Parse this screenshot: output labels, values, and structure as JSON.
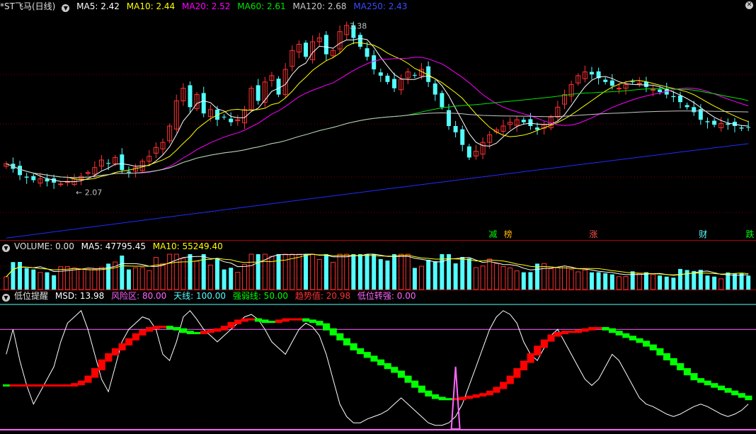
{
  "colors": {
    "bg": "#000000",
    "up": "#ff3232",
    "down": "#54ffff",
    "ma5": "#ffffff",
    "ma10": "#ffff00",
    "ma20": "#ff00ff",
    "ma60": "#00e600",
    "ma120": "#c8c8c8",
    "ma250": "#1e2cff",
    "grid": "#7a0000"
  },
  "main_legend": {
    "title": "*ST飞马(日线)",
    "ma5": "MA5: 2.42",
    "ma10": "MA10: 2.44",
    "ma20": "MA20: 2.52",
    "ma60": "MA60: 2.61",
    "ma120": "MA120: 2.68",
    "ma250": "MA250: 2.43"
  },
  "vol_legend": {
    "volume": "VOLUME: 0.00",
    "ma5": "MA5: 47795.45",
    "ma10": "MA10: 55249.40"
  },
  "ind_legend": {
    "name": "低位提醒",
    "msd": "MSD: 13.98",
    "risk": "风险区: 80.00",
    "sky": "天线: 100.00",
    "strong": "强弱线: 50.00",
    "trend": "趋势值: 20.98",
    "low": "低位转强: 0.00"
  },
  "annotations": {
    "high_label": "3.38",
    "low_label": "← 2.07"
  },
  "event_markers": [
    {
      "label": "减",
      "color": "#00ff00",
      "pos": 0.652
    },
    {
      "label": "榜",
      "color": "#ffb400",
      "pos": 0.672
    },
    {
      "label": "涨",
      "color": "#ff5050",
      "pos": 0.785
    },
    {
      "label": "财",
      "color": "#54ffff",
      "pos": 0.93
    },
    {
      "label": "跌",
      "color": "#00ff00",
      "pos": 0.992
    }
  ],
  "chart_data": {
    "type": "candlestick",
    "title": "*ST飞马(日线)",
    "price_range": [
      1.65,
      3.45
    ],
    "high": 3.38,
    "low": 2.07,
    "closes": [
      2.25,
      2.21,
      2.16,
      2.14,
      2.12,
      2.13,
      2.11,
      2.1,
      2.09,
      2.11,
      2.13,
      2.15,
      2.18,
      2.22,
      2.28,
      2.25,
      2.3,
      2.2,
      2.18,
      2.22,
      2.27,
      2.31,
      2.38,
      2.42,
      2.55,
      2.75,
      2.85,
      2.7,
      2.8,
      2.65,
      2.68,
      2.6,
      2.62,
      2.58,
      2.6,
      2.68,
      2.85,
      2.75,
      2.9,
      2.95,
      2.8,
      3.0,
      3.15,
      3.2,
      3.1,
      3.22,
      3.25,
      3.12,
      3.15,
      3.3,
      3.35,
      3.25,
      3.18,
      3.1,
      3.0,
      2.95,
      2.9,
      2.85,
      2.92,
      2.98,
      2.95,
      3.0,
      2.9,
      2.8,
      2.7,
      2.55,
      2.5,
      2.4,
      2.3,
      2.35,
      2.42,
      2.48,
      2.52,
      2.55,
      2.58,
      2.6,
      2.58,
      2.55,
      2.52,
      2.56,
      2.62,
      2.7,
      2.8,
      2.88,
      2.95,
      2.98,
      2.96,
      2.93,
      2.9,
      2.87,
      2.85,
      2.88,
      2.9,
      2.89,
      2.86,
      2.84,
      2.82,
      2.8,
      2.78,
      2.74,
      2.7,
      2.66,
      2.6,
      2.58,
      2.56,
      2.57,
      2.56,
      2.55,
      2.53,
      2.54
    ],
    "candle_count": 110,
    "volume": {
      "ma5": 47795.45,
      "ma10": 55249.4
    },
    "indicator": {
      "name": "低位提醒",
      "msd": 13.98,
      "risk_zone": 80.0,
      "sky_line": 100.0,
      "strength_line": 50.0,
      "trend_value": 20.98,
      "low_turn_strong": 0.0,
      "trend_series": [
        35,
        35,
        35,
        35,
        35,
        35,
        35,
        35,
        35,
        35,
        36,
        38,
        42,
        48,
        55,
        60,
        64,
        68,
        72,
        76,
        79,
        81,
        82,
        82,
        81,
        80,
        78,
        77,
        77,
        78,
        79,
        80,
        82,
        85,
        87,
        88,
        88,
        87,
        86,
        86,
        87,
        88,
        88,
        88,
        87,
        86,
        84,
        80,
        76,
        72,
        68,
        64,
        61,
        58,
        55,
        52,
        49,
        46,
        42,
        38,
        34,
        30,
        27,
        25,
        24,
        24,
        24,
        25,
        26,
        27,
        28,
        30,
        33,
        37,
        42,
        48,
        54,
        60,
        66,
        71,
        75,
        77,
        78,
        78,
        79,
        80,
        81,
        81,
        80,
        78,
        76,
        74,
        72,
        70,
        67,
        64,
        60,
        56,
        52,
        48,
        44,
        40,
        38,
        36,
        34,
        32,
        30,
        28,
        26,
        24
      ],
      "msd_series": [
        60,
        80,
        55,
        35,
        20,
        30,
        40,
        50,
        70,
        85,
        90,
        95,
        80,
        60,
        40,
        30,
        50,
        70,
        80,
        85,
        90,
        88,
        80,
        60,
        55,
        70,
        90,
        95,
        88,
        80,
        75,
        70,
        75,
        80,
        85,
        90,
        92,
        88,
        80,
        70,
        65,
        60,
        70,
        80,
        85,
        82,
        75,
        60,
        40,
        20,
        10,
        5,
        5,
        8,
        10,
        12,
        15,
        20,
        25,
        20,
        15,
        10,
        5,
        3,
        3,
        5,
        10,
        20,
        35,
        50,
        65,
        80,
        90,
        95,
        92,
        85,
        70,
        60,
        55,
        65,
        75,
        80,
        70,
        60,
        50,
        40,
        35,
        40,
        50,
        60,
        55,
        45,
        35,
        25,
        20,
        18,
        15,
        12,
        10,
        12,
        15,
        18,
        20,
        18,
        15,
        12,
        10,
        12,
        15,
        20
      ],
      "low_signal_index": 66
    }
  }
}
